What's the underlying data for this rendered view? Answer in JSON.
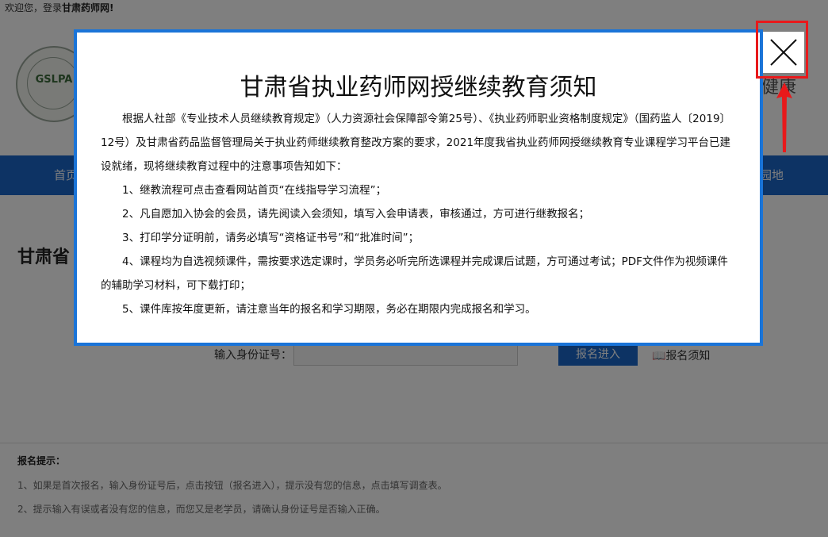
{
  "topbar": {
    "welcome_prefix": "欢迎您，登录",
    "site_name": "甘肃药师网!"
  },
  "logo": {
    "text": "GSLPA"
  },
  "header": {
    "right_text": "健康"
  },
  "nav": {
    "items": [
      "首页",
      "园地"
    ]
  },
  "page": {
    "title": "甘肃省"
  },
  "form": {
    "id_label": "输入身份证号：",
    "id_value": "",
    "register_button": "报名进入",
    "notice_link": "报名须知"
  },
  "tips": {
    "title": "报名提示：",
    "items": [
      "1、如果是首次报名，输入身份证号后，点击按钮（报名进入），提示没有您的信息，点击填写调查表。",
      "2、提示输入有误或者没有您的信息，而您又是老学员，请确认身份证号是否输入正确。"
    ]
  },
  "modal": {
    "title": "甘肃省执业药师网授继续教育须知",
    "intro": "根据人社部《专业技术人员继续教育规定》（人力资源社会保障部令第25号）、《执业药师职业资格制度规定》（国药监人〔2019〕12号）及甘肃省药品监督管理局关于执业药师继续教育整改方案的要求，2021年度我省执业药师网授继续教育专业课程学习平台已建设就绪，现将继续教育过程中的注意事项告知如下：",
    "items": [
      "1、继教流程可点击查看网站首页“在线指导学习流程”；",
      "2、凡自愿加入协会的会员，请先阅读入会须知，填写入会申请表，审核通过，方可进行继教报名；",
      "3、打印学分证明前，请务必填写“资格证书号”和“批准时间”；",
      "4、课程均为自选视频课件，需按要求选定课时，学员务必听完所选课程并完成课后试题，方可通过考试；PDF文件作为视频课件的辅助学习材料，可下载打印；",
      "5、课件库按年度更新，请注意当年的报名和学习期限，务必在期限内完成报名和学习。"
    ],
    "close_icon": "close-icon"
  },
  "colors": {
    "accent": "#1a74d8",
    "nav": "#1a66c8",
    "highlight": "#e8191b"
  }
}
